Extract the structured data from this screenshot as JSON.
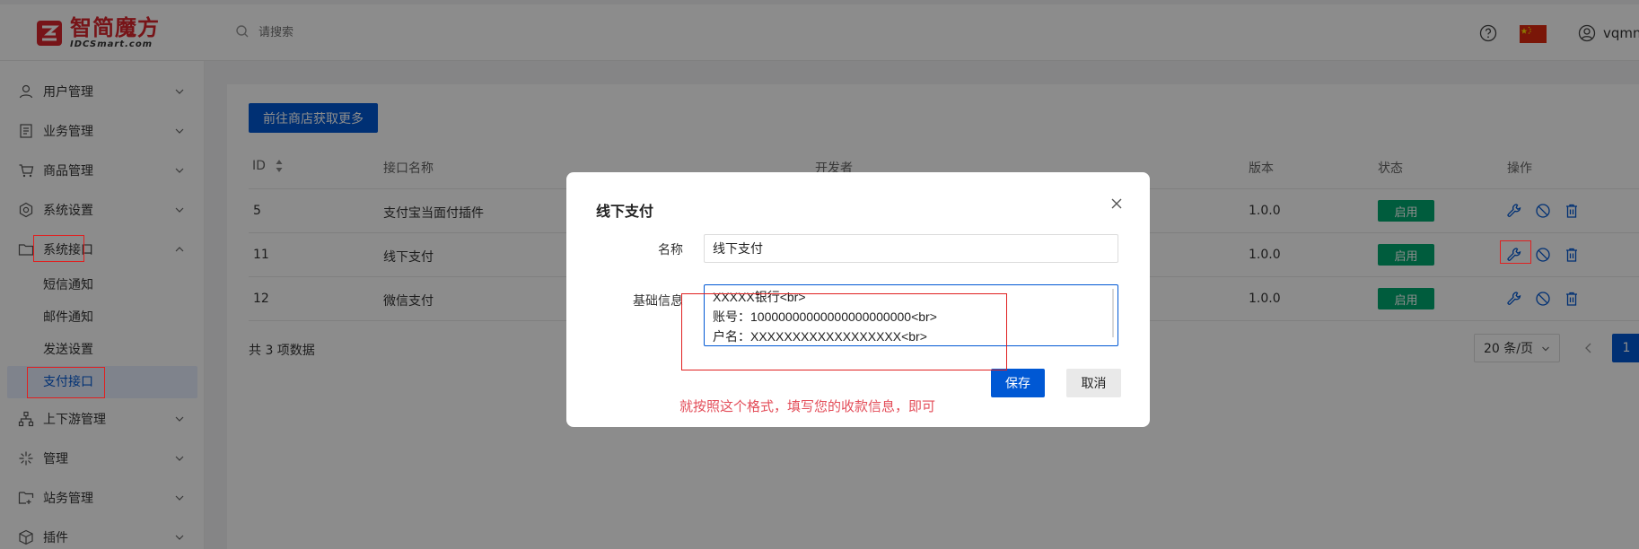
{
  "header": {
    "logo_cn": "智简魔方",
    "logo_en": "IDCSmart.com",
    "search_placeholder": "请搜索",
    "username": "vqmn"
  },
  "sidebar": {
    "items": [
      {
        "label": "用户管理",
        "icon": "user-icon"
      },
      {
        "label": "业务管理",
        "icon": "document-icon"
      },
      {
        "label": "商品管理",
        "icon": "cart-icon"
      },
      {
        "label": "系统设置",
        "icon": "gear-icon"
      },
      {
        "label": "系统接口",
        "icon": "folder-icon",
        "expanded": true
      },
      {
        "label": "上下游管理",
        "icon": "network-icon"
      },
      {
        "label": "管理",
        "icon": "asterisk-icon"
      },
      {
        "label": "站务管理",
        "icon": "chat-folder-icon"
      },
      {
        "label": "插件",
        "icon": "cube-icon"
      }
    ],
    "sub_items": [
      {
        "label": "短信通知"
      },
      {
        "label": "邮件通知"
      },
      {
        "label": "发送设置"
      },
      {
        "label": "支付接口",
        "active": true
      }
    ]
  },
  "toolbar": {
    "store_button": "前往商店获取更多"
  },
  "table": {
    "headers": {
      "id": "ID",
      "name": "接口名称",
      "developer": "开发者",
      "version": "版本",
      "status": "状态",
      "actions": "操作"
    },
    "rows": [
      {
        "id": "5",
        "name": "支付宝当面付插件",
        "version": "1.0.0",
        "status": "启用"
      },
      {
        "id": "11",
        "name": "线下支付",
        "version": "1.0.0",
        "status": "启用"
      },
      {
        "id": "12",
        "name": "微信支付",
        "version": "1.0.0",
        "status": "启用"
      }
    ]
  },
  "pagination": {
    "total": "共 3 项数据",
    "page_size": "20 条/页",
    "current": "1"
  },
  "modal": {
    "title": "线下支付",
    "name_label": "名称",
    "name_value": "线下支付",
    "info_label": "基础信息",
    "info_lines": [
      "XXXXX银行<br>",
      "账号：10000000000000000000000<br>",
      "户名：XXXXXXXXXXXXXXXXXX<br>"
    ],
    "save": "保存",
    "cancel": "取消",
    "hint": "就按照这个格式，填写您的收款信息，即可"
  },
  "colors": {
    "primary": "#0058d4",
    "success": "#00a870",
    "annotation": "#e02020",
    "hint": "#e34d59"
  }
}
